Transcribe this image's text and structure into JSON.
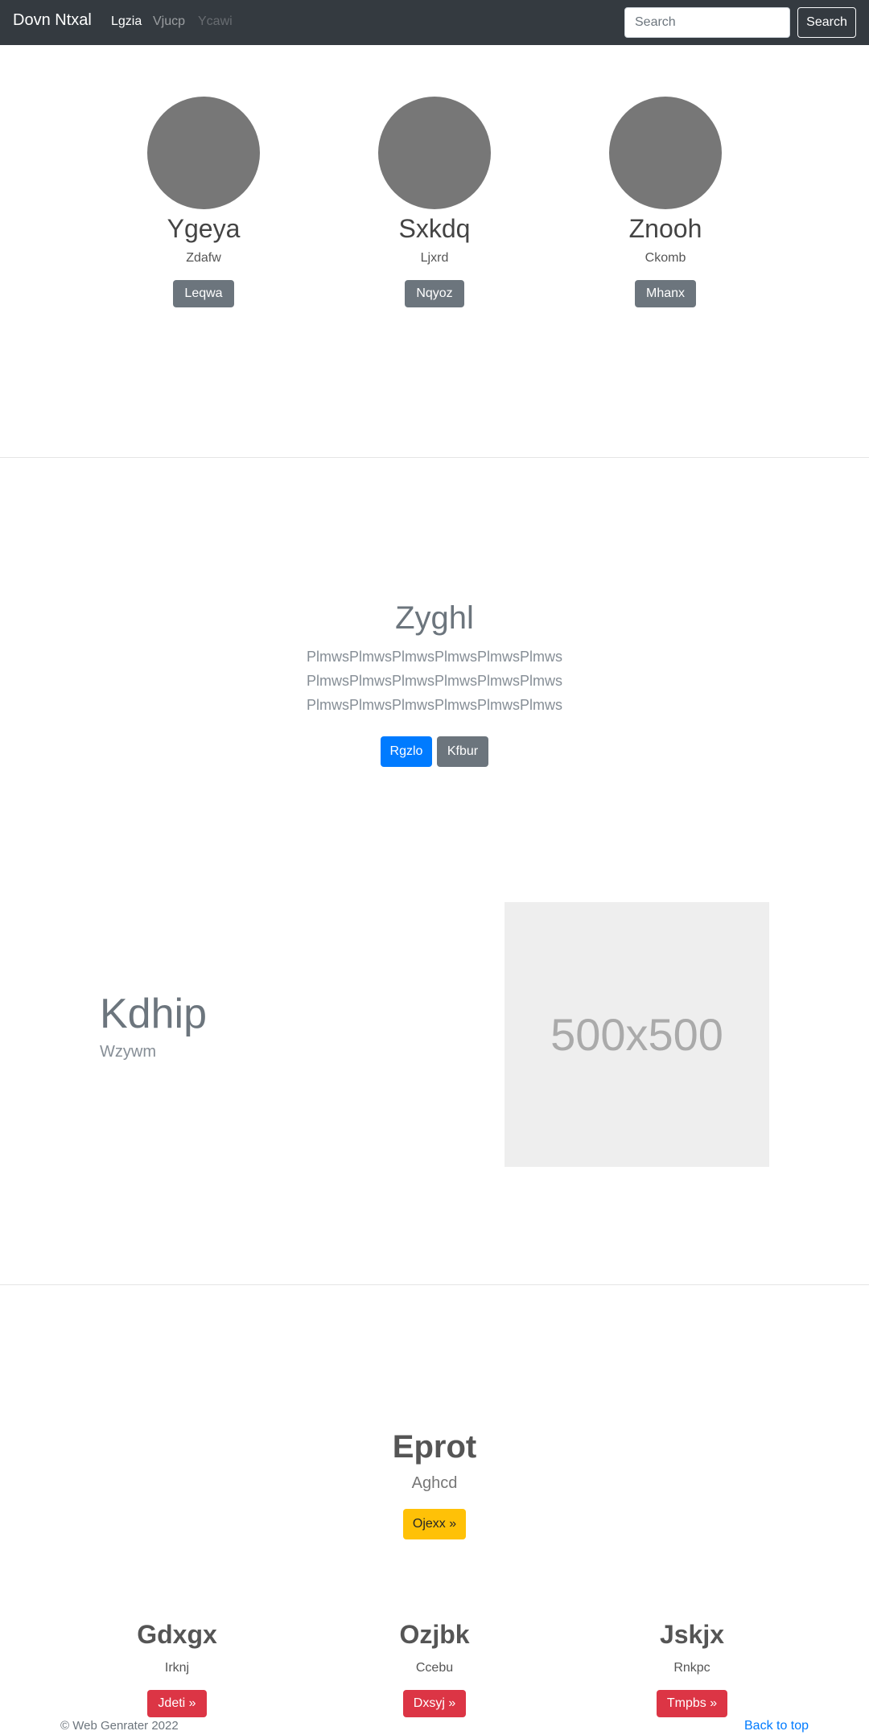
{
  "navbar": {
    "brand": "Dovn Ntxal",
    "links": [
      "Lgzia",
      "Vjucp",
      "Ycawi"
    ],
    "search_placeholder": "Search",
    "search_button": "Search"
  },
  "profiles": [
    {
      "name": "Ygeya",
      "subtitle": "Zdafw",
      "button": "Leqwa"
    },
    {
      "name": "Sxkdq",
      "subtitle": "Ljxrd",
      "button": "Nqyoz"
    },
    {
      "name": "Znooh",
      "subtitle": "Ckomb",
      "button": "Mhanx"
    }
  ],
  "hero": {
    "title": "Zyghl",
    "lines": [
      "PlmwsPlmwsPlmwsPlmwsPlmwsPlmws",
      "PlmwsPlmwsPlmwsPlmwsPlmwsPlmws",
      "PlmwsPlmwsPlmwsPlmwsPlmwsPlmws"
    ],
    "primary_button": "Rgzlo",
    "secondary_button": "Kfbur"
  },
  "feature": {
    "heading": "Kdhip",
    "subheading": "Wzywm",
    "image_label": "500x500"
  },
  "jumbotron": {
    "title": "Eprot",
    "subtitle": "Aghcd",
    "button": "Ojexx »"
  },
  "columns": [
    {
      "title": "Gdxgx",
      "subtitle": "Irknj",
      "button": "Jdeti »"
    },
    {
      "title": "Ozjbk",
      "subtitle": "Ccebu",
      "button": "Dxsyj »"
    },
    {
      "title": "Jskjx",
      "subtitle": "Rnkpc",
      "button": "Tmpbs »"
    }
  ],
  "footer": {
    "copyright": "© Web Genrater 2022",
    "back_to_top": "Back to top"
  }
}
